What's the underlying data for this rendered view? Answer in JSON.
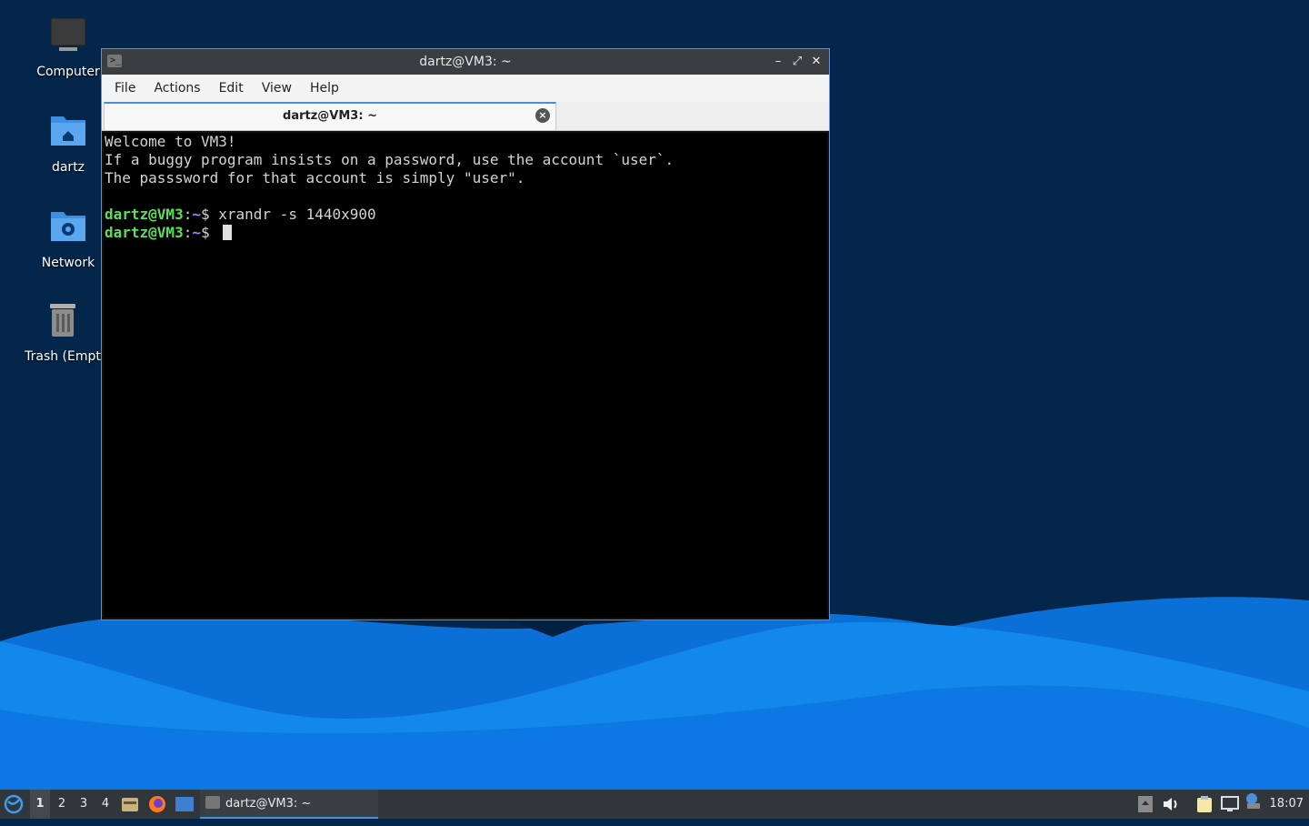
{
  "desktop": {
    "icons": [
      {
        "label": "Computer"
      },
      {
        "label": "dartz"
      },
      {
        "label": "Network"
      },
      {
        "label": "Trash (Empt"
      }
    ]
  },
  "window": {
    "title": "dartz@VM3: ~",
    "controls": {
      "minimize": "–",
      "maximize": "⤢",
      "close": "✕"
    },
    "menu": [
      "File",
      "Actions",
      "Edit",
      "View",
      "Help"
    ],
    "tab": {
      "label": "dartz@VM3: ~",
      "close": "×"
    }
  },
  "terminal": {
    "lines": [
      "Welcome to VM3!",
      "If a buggy program insists on a password, use the account `user`.",
      "The passsword for that account is simply \"user\"."
    ],
    "prompt_user": "dartz@VM3",
    "prompt_sep": ":",
    "prompt_path": "~",
    "prompt_end": "$ ",
    "command1": "xrandr -s 1440x900"
  },
  "taskbar": {
    "workspaces": [
      "1",
      "2",
      "3",
      "4"
    ],
    "active_workspace": "1",
    "task_label": "dartz@VM3: ~",
    "clock": "18:07"
  },
  "colors": {
    "accent": "#4a90d9",
    "prompt_user": "#5ae05a",
    "prompt_path": "#8d8dff"
  }
}
